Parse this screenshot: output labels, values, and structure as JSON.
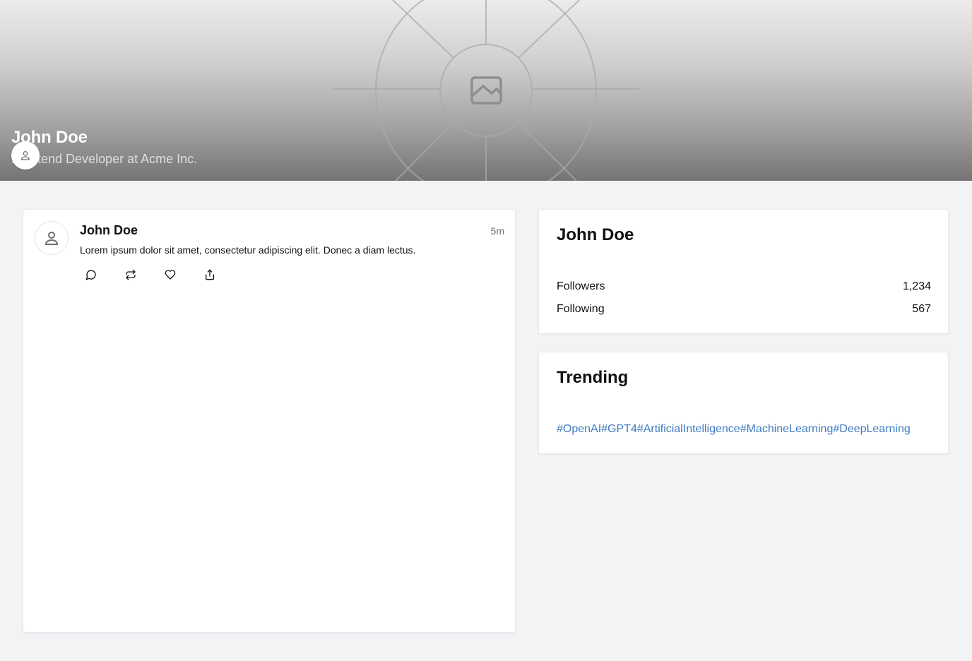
{
  "header": {
    "name": "John Doe",
    "subtitle": "Frontend Developer at Acme Inc."
  },
  "post": {
    "author": "John Doe",
    "time": "5m",
    "text": "Lorem ipsum dolor sit amet, consectetur adipiscing elit. Donec a diam lectus.",
    "actions": [
      "comment-icon",
      "repost-icon",
      "heart-icon",
      "share-icon"
    ]
  },
  "profile_card": {
    "title": "John Doe",
    "stats": [
      {
        "label": "Followers",
        "value": "1,234"
      },
      {
        "label": "Following",
        "value": "567"
      }
    ]
  },
  "trending": {
    "title": "Trending",
    "tags": [
      "#OpenAI",
      "#GPT4",
      "#ArtificialIntelligence",
      "#MachineLearning",
      "#DeepLearning"
    ]
  },
  "colors": {
    "page_bg": "#f2f3f5",
    "card_bg": "#ffffff",
    "hashtag": "#3f7bc2"
  }
}
